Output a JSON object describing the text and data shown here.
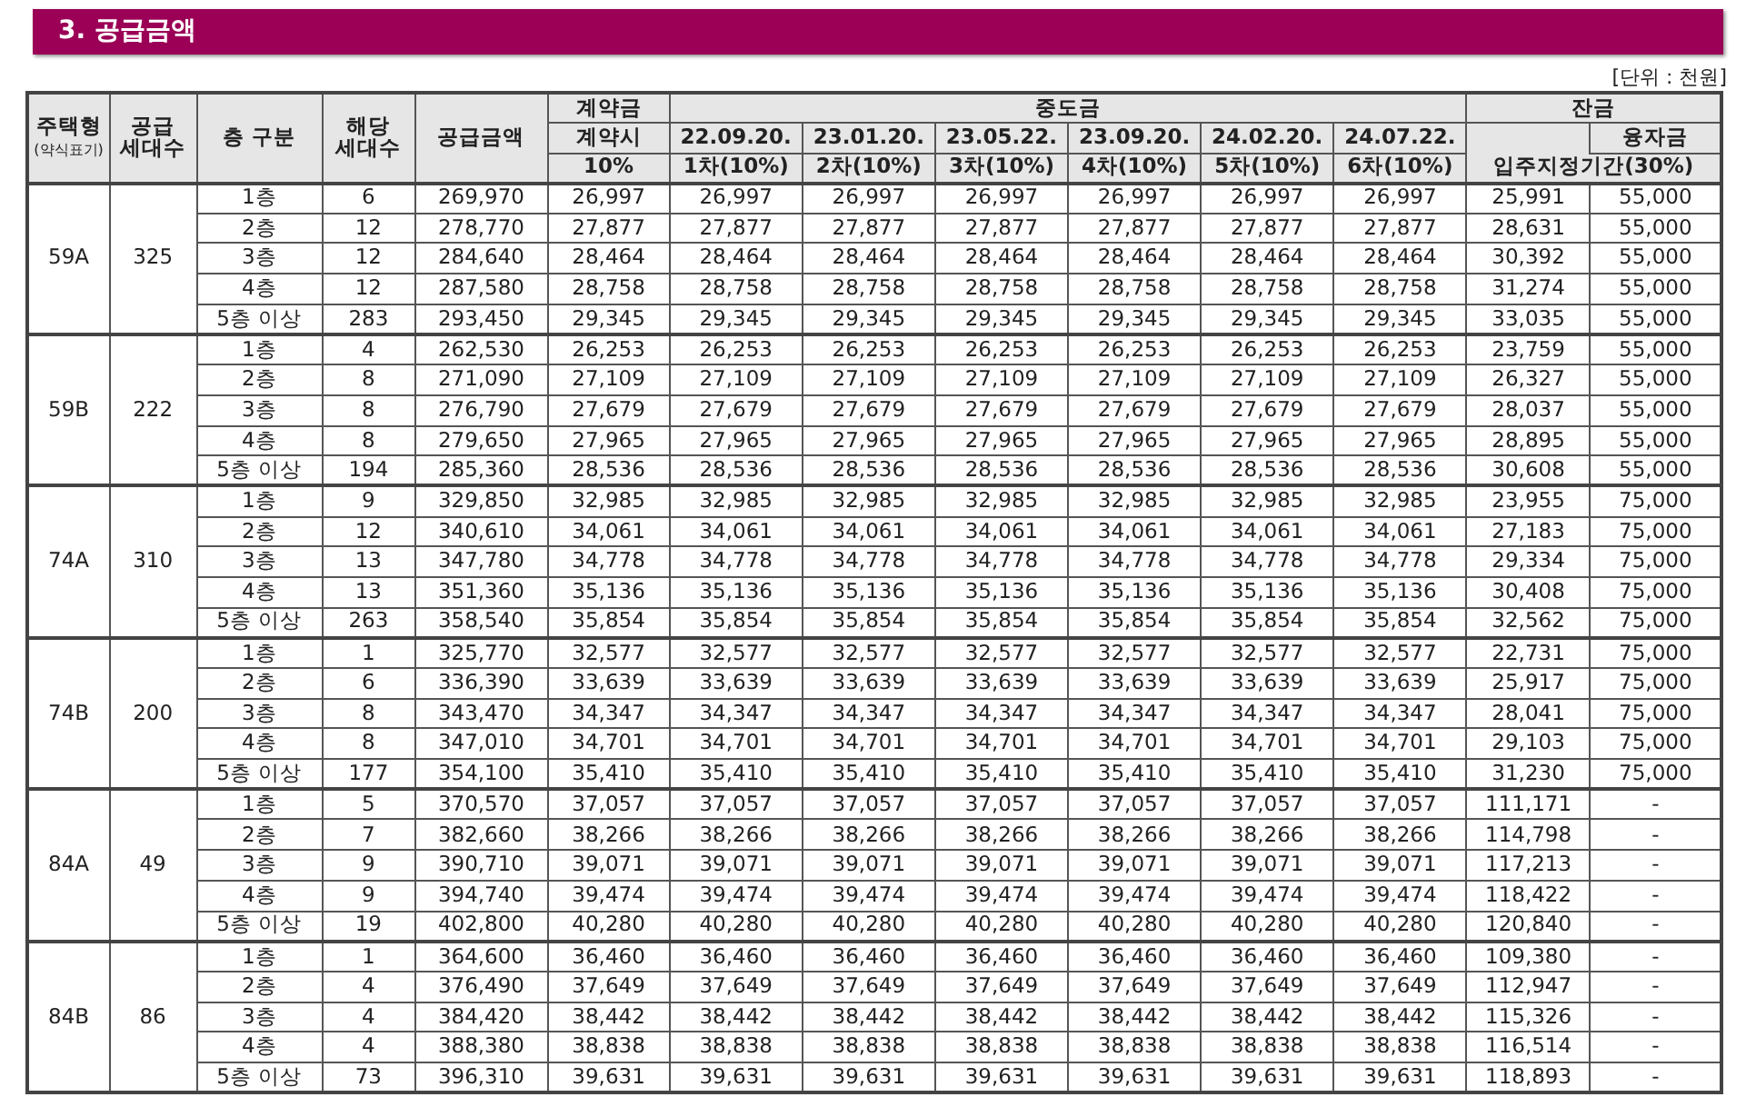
{
  "section_title": "3. 공급금액",
  "unit_note": "[단위 : 천원]",
  "table": {
    "columns": [
      {
        "lines": [
          "주택형"
        ],
        "note": "(약식표기)"
      },
      {
        "lines": [
          "공급",
          "세대수"
        ]
      },
      {
        "lines": [
          "층 구분"
        ]
      },
      {
        "lines": [
          "해당",
          "세대수"
        ]
      },
      {
        "lines": [
          "공급금액"
        ]
      }
    ],
    "deposit": {
      "title": "계약금",
      "when": "계약시",
      "rate": "10%"
    },
    "interim": {
      "title": "중도금",
      "installments": [
        {
          "date": "22.09.20.",
          "label": "1차(10%)"
        },
        {
          "date": "23.01.20.",
          "label": "2차(10%)"
        },
        {
          "date": "23.05.22.",
          "label": "3차(10%)"
        },
        {
          "date": "23.09.20.",
          "label": "4차(10%)"
        },
        {
          "date": "24.02.20.",
          "label": "5차(10%)"
        },
        {
          "date": "24.07.22.",
          "label": "6차(10%)"
        }
      ]
    },
    "balance": {
      "title": "잔금",
      "loan": "융자금",
      "period": "입주지정기간(30%)"
    },
    "groups": [
      {
        "type": "59A",
        "households": "325",
        "rows": [
          {
            "floor": "1층",
            "units": "6",
            "price": "269,970",
            "deposit": "26,997",
            "interim": [
              "26,997",
              "26,997",
              "26,997",
              "26,997",
              "26,997",
              "26,997"
            ],
            "balance": "25,991",
            "loan": "55,000"
          },
          {
            "floor": "2층",
            "units": "12",
            "price": "278,770",
            "deposit": "27,877",
            "interim": [
              "27,877",
              "27,877",
              "27,877",
              "27,877",
              "27,877",
              "27,877"
            ],
            "balance": "28,631",
            "loan": "55,000"
          },
          {
            "floor": "3층",
            "units": "12",
            "price": "284,640",
            "deposit": "28,464",
            "interim": [
              "28,464",
              "28,464",
              "28,464",
              "28,464",
              "28,464",
              "28,464"
            ],
            "balance": "30,392",
            "loan": "55,000"
          },
          {
            "floor": "4층",
            "units": "12",
            "price": "287,580",
            "deposit": "28,758",
            "interim": [
              "28,758",
              "28,758",
              "28,758",
              "28,758",
              "28,758",
              "28,758"
            ],
            "balance": "31,274",
            "loan": "55,000"
          },
          {
            "floor": "5층 이상",
            "units": "283",
            "price": "293,450",
            "deposit": "29,345",
            "interim": [
              "29,345",
              "29,345",
              "29,345",
              "29,345",
              "29,345",
              "29,345"
            ],
            "balance": "33,035",
            "loan": "55,000"
          }
        ]
      },
      {
        "type": "59B",
        "households": "222",
        "rows": [
          {
            "floor": "1층",
            "units": "4",
            "price": "262,530",
            "deposit": "26,253",
            "interim": [
              "26,253",
              "26,253",
              "26,253",
              "26,253",
              "26,253",
              "26,253"
            ],
            "balance": "23,759",
            "loan": "55,000"
          },
          {
            "floor": "2층",
            "units": "8",
            "price": "271,090",
            "deposit": "27,109",
            "interim": [
              "27,109",
              "27,109",
              "27,109",
              "27,109",
              "27,109",
              "27,109"
            ],
            "balance": "26,327",
            "loan": "55,000"
          },
          {
            "floor": "3층",
            "units": "8",
            "price": "276,790",
            "deposit": "27,679",
            "interim": [
              "27,679",
              "27,679",
              "27,679",
              "27,679",
              "27,679",
              "27,679"
            ],
            "balance": "28,037",
            "loan": "55,000"
          },
          {
            "floor": "4층",
            "units": "8",
            "price": "279,650",
            "deposit": "27,965",
            "interim": [
              "27,965",
              "27,965",
              "27,965",
              "27,965",
              "27,965",
              "27,965"
            ],
            "balance": "28,895",
            "loan": "55,000"
          },
          {
            "floor": "5층 이상",
            "units": "194",
            "price": "285,360",
            "deposit": "28,536",
            "interim": [
              "28,536",
              "28,536",
              "28,536",
              "28,536",
              "28,536",
              "28,536"
            ],
            "balance": "30,608",
            "loan": "55,000"
          }
        ]
      },
      {
        "type": "74A",
        "households": "310",
        "rows": [
          {
            "floor": "1층",
            "units": "9",
            "price": "329,850",
            "deposit": "32,985",
            "interim": [
              "32,985",
              "32,985",
              "32,985",
              "32,985",
              "32,985",
              "32,985"
            ],
            "balance": "23,955",
            "loan": "75,000"
          },
          {
            "floor": "2층",
            "units": "12",
            "price": "340,610",
            "deposit": "34,061",
            "interim": [
              "34,061",
              "34,061",
              "34,061",
              "34,061",
              "34,061",
              "34,061"
            ],
            "balance": "27,183",
            "loan": "75,000"
          },
          {
            "floor": "3층",
            "units": "13",
            "price": "347,780",
            "deposit": "34,778",
            "interim": [
              "34,778",
              "34,778",
              "34,778",
              "34,778",
              "34,778",
              "34,778"
            ],
            "balance": "29,334",
            "loan": "75,000"
          },
          {
            "floor": "4층",
            "units": "13",
            "price": "351,360",
            "deposit": "35,136",
            "interim": [
              "35,136",
              "35,136",
              "35,136",
              "35,136",
              "35,136",
              "35,136"
            ],
            "balance": "30,408",
            "loan": "75,000"
          },
          {
            "floor": "5층 이상",
            "units": "263",
            "price": "358,540",
            "deposit": "35,854",
            "interim": [
              "35,854",
              "35,854",
              "35,854",
              "35,854",
              "35,854",
              "35,854"
            ],
            "balance": "32,562",
            "loan": "75,000"
          }
        ]
      },
      {
        "type": "74B",
        "households": "200",
        "rows": [
          {
            "floor": "1층",
            "units": "1",
            "price": "325,770",
            "deposit": "32,577",
            "interim": [
              "32,577",
              "32,577",
              "32,577",
              "32,577",
              "32,577",
              "32,577"
            ],
            "balance": "22,731",
            "loan": "75,000"
          },
          {
            "floor": "2층",
            "units": "6",
            "price": "336,390",
            "deposit": "33,639",
            "interim": [
              "33,639",
              "33,639",
              "33,639",
              "33,639",
              "33,639",
              "33,639"
            ],
            "balance": "25,917",
            "loan": "75,000"
          },
          {
            "floor": "3층",
            "units": "8",
            "price": "343,470",
            "deposit": "34,347",
            "interim": [
              "34,347",
              "34,347",
              "34,347",
              "34,347",
              "34,347",
              "34,347"
            ],
            "balance": "28,041",
            "loan": "75,000"
          },
          {
            "floor": "4층",
            "units": "8",
            "price": "347,010",
            "deposit": "34,701",
            "interim": [
              "34,701",
              "34,701",
              "34,701",
              "34,701",
              "34,701",
              "34,701"
            ],
            "balance": "29,103",
            "loan": "75,000"
          },
          {
            "floor": "5층 이상",
            "units": "177",
            "price": "354,100",
            "deposit": "35,410",
            "interim": [
              "35,410",
              "35,410",
              "35,410",
              "35,410",
              "35,410",
              "35,410"
            ],
            "balance": "31,230",
            "loan": "75,000"
          }
        ]
      },
      {
        "type": "84A",
        "households": "49",
        "rows": [
          {
            "floor": "1층",
            "units": "5",
            "price": "370,570",
            "deposit": "37,057",
            "interim": [
              "37,057",
              "37,057",
              "37,057",
              "37,057",
              "37,057",
              "37,057"
            ],
            "balance": "111,171",
            "loan": "-"
          },
          {
            "floor": "2층",
            "units": "7",
            "price": "382,660",
            "deposit": "38,266",
            "interim": [
              "38,266",
              "38,266",
              "38,266",
              "38,266",
              "38,266",
              "38,266"
            ],
            "balance": "114,798",
            "loan": "-"
          },
          {
            "floor": "3층",
            "units": "9",
            "price": "390,710",
            "deposit": "39,071",
            "interim": [
              "39,071",
              "39,071",
              "39,071",
              "39,071",
              "39,071",
              "39,071"
            ],
            "balance": "117,213",
            "loan": "-"
          },
          {
            "floor": "4층",
            "units": "9",
            "price": "394,740",
            "deposit": "39,474",
            "interim": [
              "39,474",
              "39,474",
              "39,474",
              "39,474",
              "39,474",
              "39,474"
            ],
            "balance": "118,422",
            "loan": "-"
          },
          {
            "floor": "5층 이상",
            "units": "19",
            "price": "402,800",
            "deposit": "40,280",
            "interim": [
              "40,280",
              "40,280",
              "40,280",
              "40,280",
              "40,280",
              "40,280"
            ],
            "balance": "120,840",
            "loan": "-"
          }
        ]
      },
      {
        "type": "84B",
        "households": "86",
        "rows": [
          {
            "floor": "1층",
            "units": "1",
            "price": "364,600",
            "deposit": "36,460",
            "interim": [
              "36,460",
              "36,460",
              "36,460",
              "36,460",
              "36,460",
              "36,460"
            ],
            "balance": "109,380",
            "loan": "-"
          },
          {
            "floor": "2층",
            "units": "4",
            "price": "376,490",
            "deposit": "37,649",
            "interim": [
              "37,649",
              "37,649",
              "37,649",
              "37,649",
              "37,649",
              "37,649"
            ],
            "balance": "112,947",
            "loan": "-"
          },
          {
            "floor": "3층",
            "units": "4",
            "price": "384,420",
            "deposit": "38,442",
            "interim": [
              "38,442",
              "38,442",
              "38,442",
              "38,442",
              "38,442",
              "38,442"
            ],
            "balance": "115,326",
            "loan": "-"
          },
          {
            "floor": "4층",
            "units": "4",
            "price": "388,380",
            "deposit": "38,838",
            "interim": [
              "38,838",
              "38,838",
              "38,838",
              "38,838",
              "38,838",
              "38,838"
            ],
            "balance": "116,514",
            "loan": "-"
          },
          {
            "floor": "5층 이상",
            "units": "73",
            "price": "396,310",
            "deposit": "39,631",
            "interim": [
              "39,631",
              "39,631",
              "39,631",
              "39,631",
              "39,631",
              "39,631"
            ],
            "balance": "118,893",
            "loan": "-"
          }
        ]
      }
    ]
  }
}
